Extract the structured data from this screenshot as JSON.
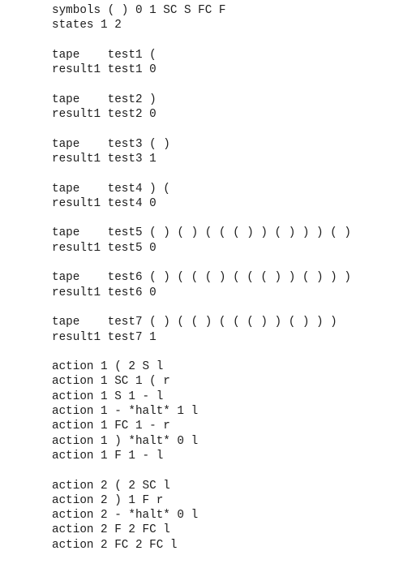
{
  "document": {
    "kind": "turing-machine-definition",
    "background_color": "#ffffff",
    "text_color": "#1c1c1c",
    "header": {
      "symbols_line": "symbols ( ) 0 1 SC S FC F",
      "states_line": "states 1 2"
    },
    "tests": [
      {
        "tape_line": "tape    test1 (",
        "result_line": "result1 test1 0",
        "name": "test1",
        "tape": "(",
        "result": "0"
      },
      {
        "tape_line": "tape    test2 )",
        "result_line": "result1 test2 0",
        "name": "test2",
        "tape": ")",
        "result": "0"
      },
      {
        "tape_line": "tape    test3 ( )",
        "result_line": "result1 test3 1",
        "name": "test3",
        "tape": "( )",
        "result": "1"
      },
      {
        "tape_line": "tape    test4 ) (",
        "result_line": "result1 test4 0",
        "name": "test4",
        "tape": ") (",
        "result": "0"
      },
      {
        "tape_line": "tape    test5 ( ) ( ) ( ( ( ) ) ( ) ) ) ( )",
        "result_line": "result1 test5 0",
        "name": "test5",
        "tape": "( ) ( ) ( ( ( ) ) ( ) ) ) ( )",
        "result": "0"
      },
      {
        "tape_line": "tape    test6 ( ) ( ( ( ) ( ( ( ) ) ( ) ) )",
        "result_line": "result1 test6 0",
        "name": "test6",
        "tape": "( ) ( ( ( ) ( ( ( ) ) ( ) ) )",
        "result": "0"
      },
      {
        "tape_line": "tape    test7 ( ) ( ( ) ( ( ( ) ) ( ) ) )",
        "result_line": "result1 test7 1",
        "name": "test7",
        "tape": "( ) ( ( ) ( ( ( ) ) ( ) ) )",
        "result": "1"
      }
    ],
    "action_blocks": [
      {
        "state": "1",
        "lines": [
          "action 1 ( 2 S l",
          "action 1 SC 1 ( r",
          "action 1 S 1 - l",
          "action 1 - *halt* 1 l",
          "action 1 FC 1 - r",
          "action 1 ) *halt* 0 l",
          "action 1 F 1 - l"
        ]
      },
      {
        "state": "2",
        "lines": [
          "action 2 ( 2 SC l",
          "action 2 ) 1 F r",
          "action 2 - *halt* 0 l",
          "action 2 F 2 FC l",
          "action 2 FC 2 FC l"
        ]
      }
    ]
  }
}
